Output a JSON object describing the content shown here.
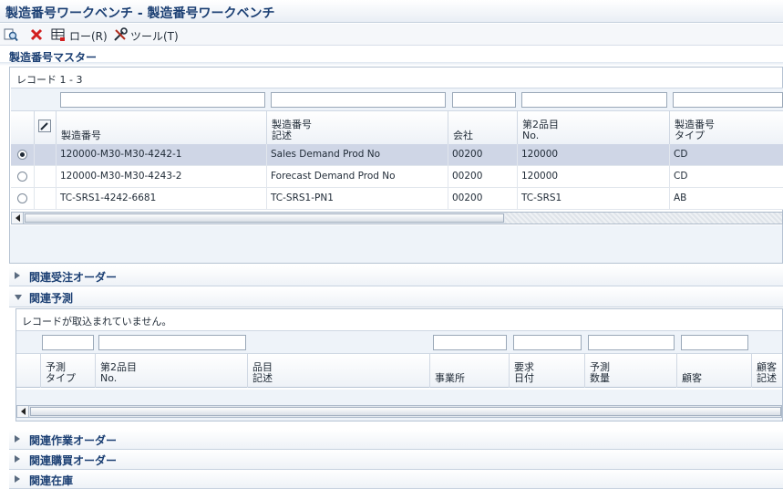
{
  "window": {
    "title": "製造番号ワークベンチ - 製造番号ワークベンチ"
  },
  "toolbar": {
    "find_icon": "find-icon",
    "close_icon": "close-icon",
    "row_icon": "row-grid-icon",
    "row_label": "ロー(R)",
    "tools_icon": "tools-icon",
    "tools_label": "ツール(T)"
  },
  "master": {
    "title": "製造番号マスター",
    "record_count": "レコード 1 - 3",
    "columns": [
      {
        "label": "製造番号"
      },
      {
        "label": "製造番号\n記述"
      },
      {
        "label": "会社"
      },
      {
        "label": "第2品目\nNo."
      },
      {
        "label": "製造番号\nタイプ"
      }
    ],
    "rows": [
      {
        "selected": true,
        "cells": [
          "120000-M30-M30-4242-1",
          "Sales Demand Prod No",
          "00200",
          "120000",
          "CD"
        ]
      },
      {
        "selected": false,
        "cells": [
          "120000-M30-M30-4243-2",
          "Forecast Demand Prod No",
          "00200",
          "120000",
          "CD"
        ]
      },
      {
        "selected": false,
        "cells": [
          "TC-SRS1-4242-6681",
          "TC-SRS1-PN1",
          "00200",
          "TC-SRS1",
          "AB"
        ]
      }
    ]
  },
  "groups": {
    "sales_orders": "関連受注オーダー",
    "forecast": "関連予測",
    "work_orders": "関連作業オーダー",
    "purchase_orders": "関連購買オーダー",
    "inventory": "関連在庫"
  },
  "forecast": {
    "no_records": "レコードが取込まれていません。",
    "columns": [
      {
        "label": "予測\nタイプ"
      },
      {
        "label": "第2品目\nNo."
      },
      {
        "label": "品目\n記述"
      },
      {
        "label": "事業所"
      },
      {
        "label": "要求\n日付"
      },
      {
        "label": "予測\n数量"
      },
      {
        "label": "顧客"
      },
      {
        "label": "顧客\n記述"
      }
    ]
  }
}
